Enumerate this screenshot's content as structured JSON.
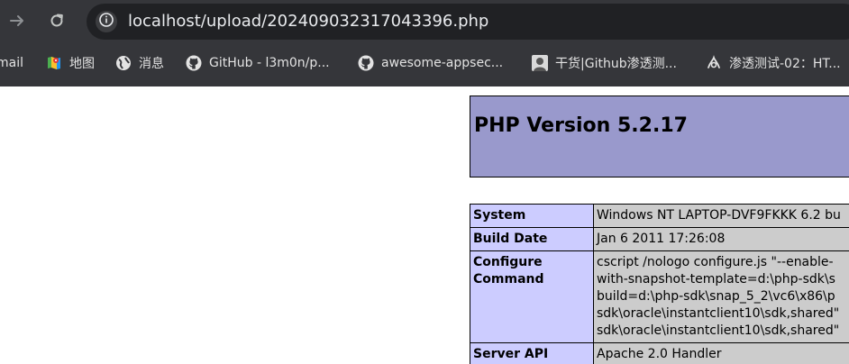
{
  "browser": {
    "url": "localhost/upload/202409032317043396.php",
    "nav": {
      "forward_icon": "arrow-right-icon",
      "reload_icon": "reload-icon"
    },
    "site_info_icon": "info-icon"
  },
  "bookmarks": [
    {
      "label": "mail",
      "icon": "none"
    },
    {
      "label": "地图",
      "icon": "maps-icon"
    },
    {
      "label": "消息",
      "icon": "globe-icon"
    },
    {
      "label": "GitHub - l3m0n/p...",
      "icon": "github-icon"
    },
    {
      "label": "awesome-appsec...",
      "icon": "github-icon"
    },
    {
      "label": "干货|Github渗透测...",
      "icon": "avatar-icon"
    },
    {
      "label": "渗透测试-02：HT...",
      "icon": "logo-icon"
    }
  ],
  "php": {
    "title": "PHP Version 5.2.17",
    "rows": [
      {
        "key": "System",
        "value": "Windows NT LAPTOP-DVF9FKKK 6.2 bu"
      },
      {
        "key": "Build Date",
        "value": "Jan 6 2011 17:26:08"
      },
      {
        "key": "Configure Command",
        "key_line1": "Configure",
        "key_line2": "Command",
        "lines": [
          "cscript /nologo configure.js \"--enable-",
          "with-snapshot-template=d:\\php-sdk\\s",
          "build=d:\\php-sdk\\snap_5_2\\vc6\\x86\\p",
          "sdk\\oracle\\instantclient10\\sdk,shared\"",
          "sdk\\oracle\\instantclient10\\sdk,shared\""
        ]
      },
      {
        "key": "Server API",
        "value": "Apache 2.0 Handler"
      }
    ]
  }
}
